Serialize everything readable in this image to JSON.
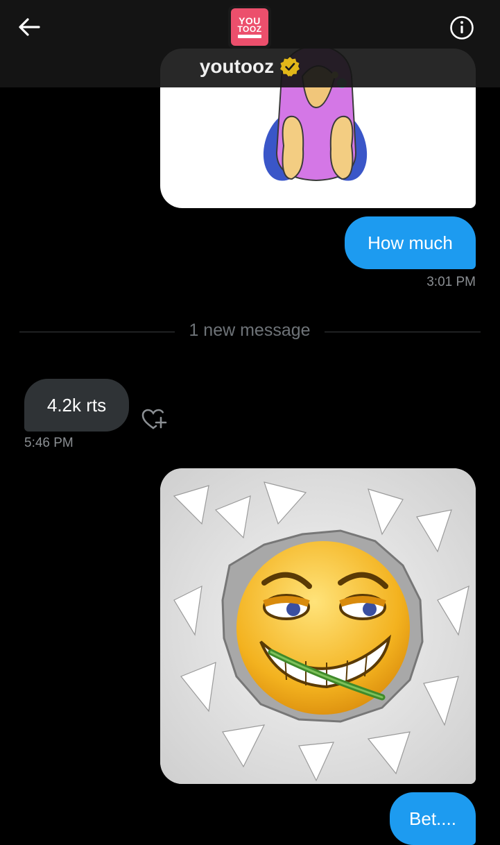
{
  "header": {
    "title": "youtooz",
    "back_icon": "arrow-left-icon",
    "info_icon": "info-icon",
    "verified_icon": "verified-badge-icon",
    "avatar": {
      "line1": "YOU",
      "line2": "TOOZ",
      "color": "#ec4f6c"
    }
  },
  "messages": [
    {
      "type": "image",
      "side": "received",
      "description_icon": "pink-bird-plush-image"
    },
    {
      "type": "text",
      "side": "sent",
      "text": "How much",
      "time": "3:01 PM"
    },
    {
      "type": "divider",
      "text": "1 new message"
    },
    {
      "type": "text",
      "side": "received",
      "text": "4.2k rts",
      "time": "5:46 PM",
      "reaction_icon": "heart-plus-icon"
    },
    {
      "type": "image",
      "side": "sent",
      "description_icon": "smirking-emoji-wall-image"
    },
    {
      "type": "text",
      "side": "sent",
      "text": "Bet...."
    }
  ],
  "colors": {
    "background": "#000000",
    "sent_bubble": "#1d9bf0",
    "received_bubble": "#2f3336",
    "timestamp": "#8b8f93",
    "verified_gold": "#e2b719"
  }
}
